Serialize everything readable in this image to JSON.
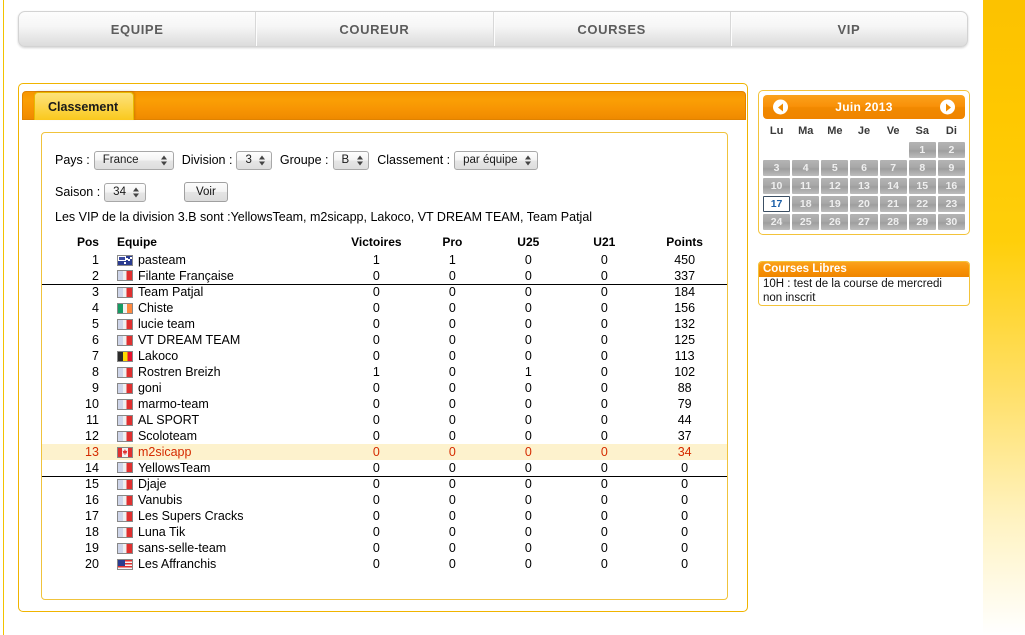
{
  "nav": {
    "tabs": [
      {
        "label": "EQUIPE",
        "name": "nav-tab-equipe"
      },
      {
        "label": "COUREUR",
        "name": "nav-tab-coureur"
      },
      {
        "label": "COURSES",
        "name": "nav-tab-courses"
      },
      {
        "label": "VIP",
        "name": "nav-tab-vip"
      }
    ]
  },
  "panel": {
    "tab_label": "Classement"
  },
  "filters": {
    "pays_label": "Pays :",
    "pays_value": "France",
    "division_label": "Division :",
    "division_value": "3",
    "groupe_label": "Groupe :",
    "groupe_value": "B",
    "classement_label": "Classement :",
    "classement_value": "par équipe",
    "saison_label": "Saison :",
    "saison_value": "34",
    "voir_button": "Voir"
  },
  "vip_note": "Les VIP de la division 3.B sont :YellowsTeam, m2sicapp, Lakoco, VT DREAM TEAM, Team Patjal",
  "table": {
    "headers": {
      "pos": "Pos",
      "equipe": "Equipe",
      "victoires": "Victoires",
      "pro": "Pro",
      "u25": "U25",
      "u21": "U21",
      "points": "Points"
    },
    "rows": [
      {
        "pos": "1",
        "team": "pasteam",
        "flag": "au",
        "victoires": "1",
        "pro": "1",
        "u25": "0",
        "u21": "0",
        "points": "450",
        "highlight": false,
        "sep_after": false
      },
      {
        "pos": "2",
        "team": "Filante Française",
        "flag": "fr",
        "victoires": "0",
        "pro": "0",
        "u25": "0",
        "u21": "0",
        "points": "337",
        "highlight": false,
        "sep_after": true
      },
      {
        "pos": "3",
        "team": "Team Patjal",
        "flag": "fr",
        "victoires": "0",
        "pro": "0",
        "u25": "0",
        "u21": "0",
        "points": "184",
        "highlight": false,
        "sep_after": false
      },
      {
        "pos": "4",
        "team": "Chiste",
        "flag": "ie",
        "victoires": "0",
        "pro": "0",
        "u25": "0",
        "u21": "0",
        "points": "156",
        "highlight": false,
        "sep_after": false
      },
      {
        "pos": "5",
        "team": "lucie team",
        "flag": "fr",
        "victoires": "0",
        "pro": "0",
        "u25": "0",
        "u21": "0",
        "points": "132",
        "highlight": false,
        "sep_after": false
      },
      {
        "pos": "6",
        "team": "VT DREAM TEAM",
        "flag": "fr",
        "victoires": "0",
        "pro": "0",
        "u25": "0",
        "u21": "0",
        "points": "125",
        "highlight": false,
        "sep_after": false
      },
      {
        "pos": "7",
        "team": "Lakoco",
        "flag": "be",
        "victoires": "0",
        "pro": "0",
        "u25": "0",
        "u21": "0",
        "points": "113",
        "highlight": false,
        "sep_after": false
      },
      {
        "pos": "8",
        "team": "Rostren Breizh",
        "flag": "fr",
        "victoires": "1",
        "pro": "0",
        "u25": "1",
        "u21": "0",
        "points": "102",
        "highlight": false,
        "sep_after": false
      },
      {
        "pos": "9",
        "team": "goni",
        "flag": "fr",
        "victoires": "0",
        "pro": "0",
        "u25": "0",
        "u21": "0",
        "points": "88",
        "highlight": false,
        "sep_after": false
      },
      {
        "pos": "10",
        "team": "marmo-team",
        "flag": "fr",
        "victoires": "0",
        "pro": "0",
        "u25": "0",
        "u21": "0",
        "points": "79",
        "highlight": false,
        "sep_after": false
      },
      {
        "pos": "11",
        "team": "AL SPORT",
        "flag": "fr",
        "victoires": "0",
        "pro": "0",
        "u25": "0",
        "u21": "0",
        "points": "44",
        "highlight": false,
        "sep_after": false
      },
      {
        "pos": "12",
        "team": "Scoloteam",
        "flag": "fr",
        "victoires": "0",
        "pro": "0",
        "u25": "0",
        "u21": "0",
        "points": "37",
        "highlight": false,
        "sep_after": false
      },
      {
        "pos": "13",
        "team": "m2sicapp",
        "flag": "ca",
        "victoires": "0",
        "pro": "0",
        "u25": "0",
        "u21": "0",
        "points": "34",
        "highlight": true,
        "sep_after": false
      },
      {
        "pos": "14",
        "team": "YellowsTeam",
        "flag": "fr",
        "victoires": "0",
        "pro": "0",
        "u25": "0",
        "u21": "0",
        "points": "0",
        "highlight": false,
        "sep_after": true
      },
      {
        "pos": "15",
        "team": "Djaje",
        "flag": "fr",
        "victoires": "0",
        "pro": "0",
        "u25": "0",
        "u21": "0",
        "points": "0",
        "highlight": false,
        "sep_after": false
      },
      {
        "pos": "16",
        "team": "Vanubis",
        "flag": "fr",
        "victoires": "0",
        "pro": "0",
        "u25": "0",
        "u21": "0",
        "points": "0",
        "highlight": false,
        "sep_after": false
      },
      {
        "pos": "17",
        "team": "Les Supers Cracks",
        "flag": "fr",
        "victoires": "0",
        "pro": "0",
        "u25": "0",
        "u21": "0",
        "points": "0",
        "highlight": false,
        "sep_after": false
      },
      {
        "pos": "18",
        "team": "Luna Tik",
        "flag": "fr",
        "victoires": "0",
        "pro": "0",
        "u25": "0",
        "u21": "0",
        "points": "0",
        "highlight": false,
        "sep_after": false
      },
      {
        "pos": "19",
        "team": "sans-selle-team",
        "flag": "fr",
        "victoires": "0",
        "pro": "0",
        "u25": "0",
        "u21": "0",
        "points": "0",
        "highlight": false,
        "sep_after": false
      },
      {
        "pos": "20",
        "team": "Les Affranchis",
        "flag": "us",
        "victoires": "0",
        "pro": "0",
        "u25": "0",
        "u21": "0",
        "points": "0",
        "highlight": false,
        "sep_after": false
      }
    ]
  },
  "calendar": {
    "title": "Juin 2013",
    "prev_icon": "chevron-left-icon",
    "next_icon": "chevron-right-icon",
    "dow": [
      "Lu",
      "Ma",
      "Me",
      "Je",
      "Ve",
      "Sa",
      "Di"
    ],
    "leading_blanks": 5,
    "days": [
      1,
      2,
      3,
      4,
      5,
      6,
      7,
      8,
      9,
      10,
      11,
      12,
      13,
      14,
      15,
      16,
      17,
      18,
      19,
      20,
      21,
      22,
      23,
      24,
      25,
      26,
      27,
      28,
      29,
      30
    ],
    "today": 17
  },
  "courses": {
    "title": "Courses Libres",
    "line1": "10H : test de la course de mercredi",
    "line2": "non inscrit"
  },
  "colors": {
    "accent_orange": "#f79200",
    "tab_yellow": "#fbd139",
    "highlight_row_bg": "#fdf2cd",
    "highlight_row_text": "#d52b00",
    "page_strip": "#fcc200"
  }
}
